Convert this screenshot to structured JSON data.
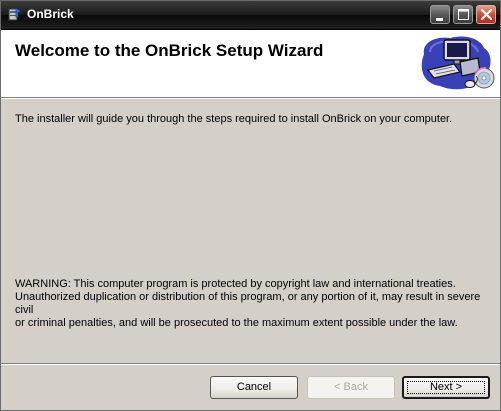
{
  "window": {
    "title": "OnBrick",
    "icon": "installer-icon"
  },
  "caption_buttons": {
    "minimize": "minimize-icon",
    "maximize": "maximize-icon",
    "close": "close-icon"
  },
  "header": {
    "title": "Welcome to the OnBrick Setup Wizard",
    "art": "computer-setup-icon"
  },
  "main": {
    "intro": "The installer will guide you through the steps required to install OnBrick on your computer.",
    "warning_lines": [
      "WARNING: This computer program is protected by copyright law and international treaties.",
      "Unauthorized duplication or distribution of this program, or any portion of it, may result in severe civil",
      "or criminal penalties, and will be prosecuted to the maximum extent possible under the law."
    ]
  },
  "buttons": {
    "cancel": "Cancel",
    "back": "< Back",
    "next": "Next >"
  }
}
